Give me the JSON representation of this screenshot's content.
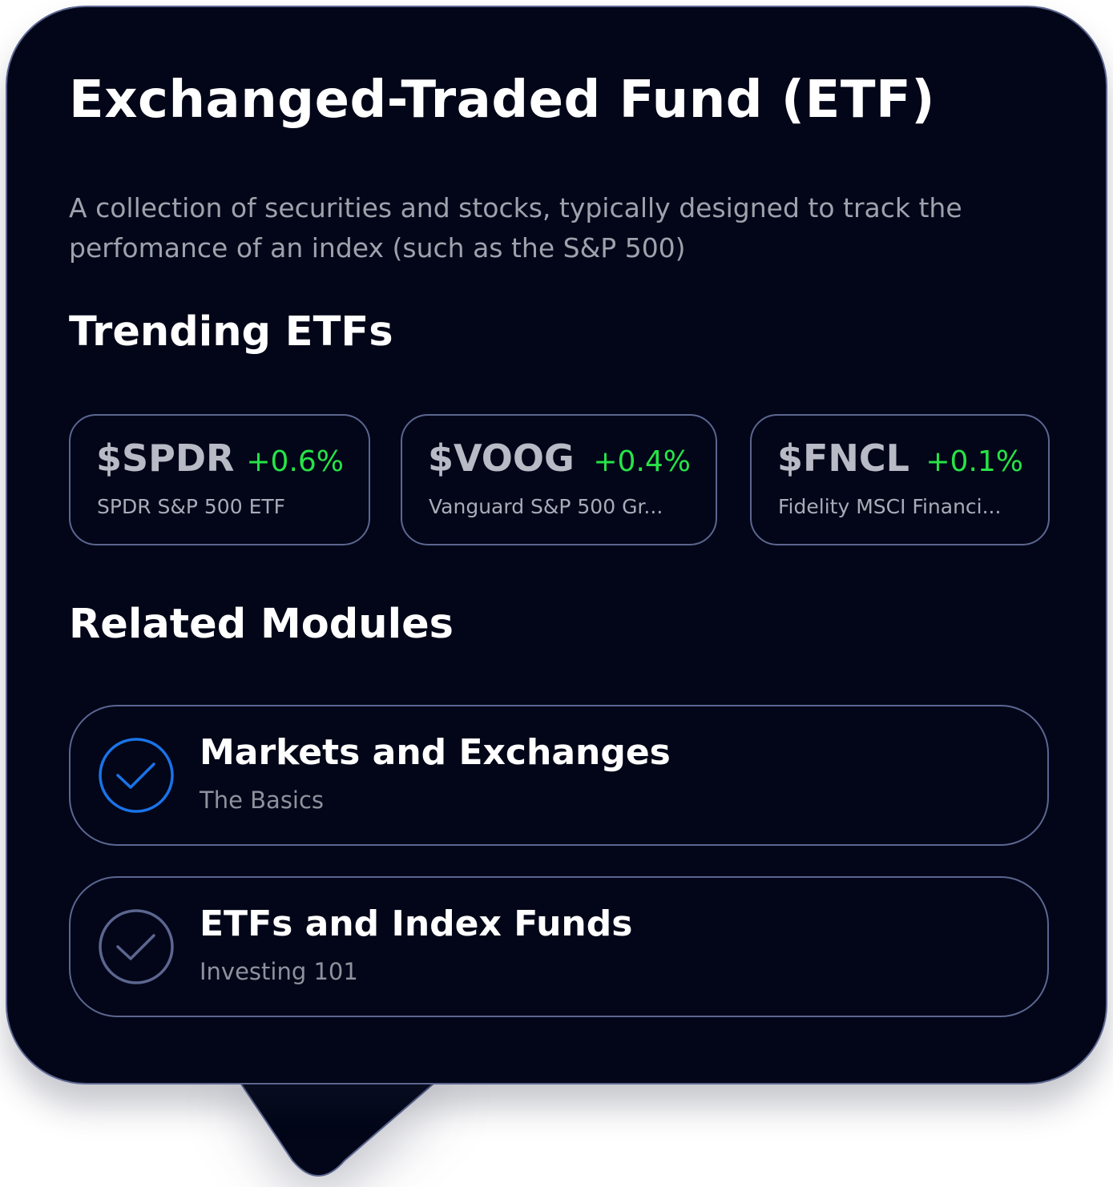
{
  "header": {
    "title": "Exchanged-Traded Fund (ETF)",
    "description": "A collection of securities and stocks, typically designed to track the perfomance of an index (such as the S&P 500)"
  },
  "trending": {
    "heading": "Trending ETFs",
    "items": [
      {
        "ticker": "$SPDR",
        "change": "+0.6%",
        "name": "SPDR S&P 500 ETF"
      },
      {
        "ticker": "$VOOG",
        "change": "+0.4%",
        "name": "Vanguard S&P 500 Gr..."
      },
      {
        "ticker": "$FNCL",
        "change": "+0.1%",
        "name": "Fidelity MSCI Financi..."
      }
    ]
  },
  "modules": {
    "heading": "Related Modules",
    "items": [
      {
        "title": "Markets and Exchanges",
        "subtitle": "The Basics",
        "completed": true,
        "icon": "check-circle-icon"
      },
      {
        "title": "ETFs and Index Funds",
        "subtitle": "Investing 101",
        "completed": false,
        "icon": "check-circle-icon"
      }
    ]
  },
  "colors": {
    "background": "#020618",
    "border": "#5c6690",
    "positive_change": "#27e347",
    "check_active": "#1a73e8",
    "check_inactive": "#5c6690"
  }
}
